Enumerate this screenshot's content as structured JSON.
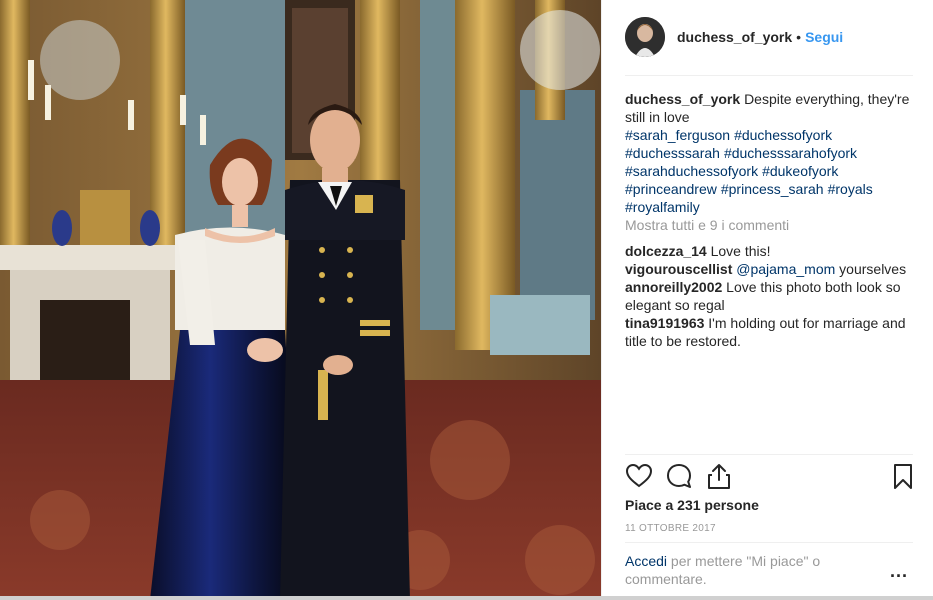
{
  "post": {
    "username": "duchess_of_york",
    "separator": "•",
    "follow_label": "Segui"
  },
  "caption": {
    "username": "duchess_of_york",
    "text": "Despite everything, they're still in love",
    "hashtags": [
      "#sarah_ferguson",
      "#duchessofyork",
      "#duchesssarah",
      "#duchesssarahofyork",
      "#sarahduchessofyork",
      "#dukeofyork",
      "#princeandrew",
      "#princess_sarah",
      "#royals",
      "#royalfamily"
    ]
  },
  "view_all_comments": "Mostra tutti e 9 i commenti",
  "comments": [
    {
      "username": "dolcezza_14",
      "text": "Love this!"
    },
    {
      "username": "vigourouscellist",
      "mention": "@pajama_mom",
      "text": "yourselves"
    },
    {
      "username": "annoreilly2002",
      "text": "Love this photo both look so elegant so regal"
    },
    {
      "username": "tina9191963",
      "text": "I'm holding out for marriage and title to be restored."
    }
  ],
  "actions": {
    "like_icon": "heart-icon",
    "comment_icon": "comment-icon",
    "share_icon": "share-icon",
    "save_icon": "bookmark-icon"
  },
  "likes_text": "Piace a 231 persone",
  "date_text": "11 ottobre 2017",
  "login_prompt": {
    "link": "Accedi",
    "text": "per mettere \"Mi piace\" o commentare."
  },
  "more_label": "..."
}
